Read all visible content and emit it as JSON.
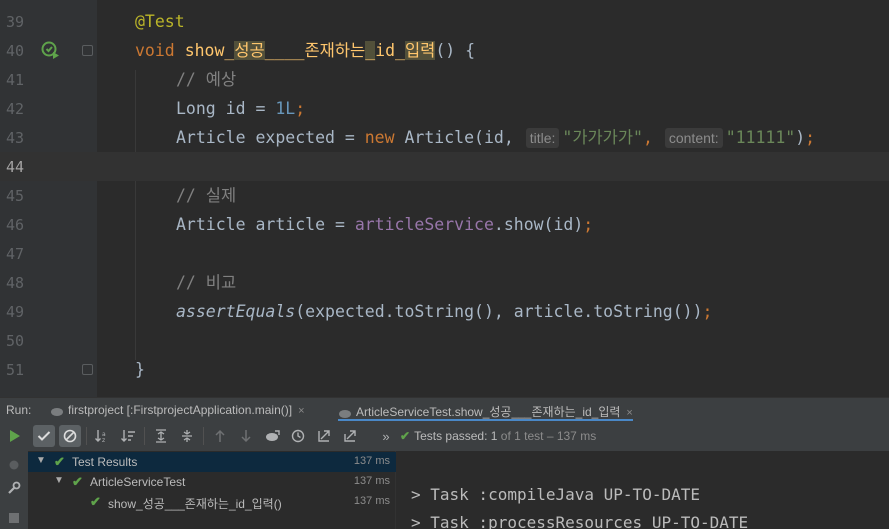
{
  "editor": {
    "lines": [
      {
        "num": "39"
      },
      {
        "num": "40"
      },
      {
        "num": "41"
      },
      {
        "num": "42"
      },
      {
        "num": "43"
      },
      {
        "num": "44"
      },
      {
        "num": "45"
      },
      {
        "num": "46"
      },
      {
        "num": "47"
      },
      {
        "num": "48"
      },
      {
        "num": "49"
      },
      {
        "num": "50"
      },
      {
        "num": "51"
      }
    ],
    "code": {
      "annotation": "@Test",
      "kw_void": "void",
      "method_start": "show_",
      "method_hl1": "성공",
      "method_mid": "____존재하는",
      "method_hl2": "_",
      "method_mid2": "id_",
      "method_hl3": "입력",
      "method_end": "() {",
      "comment_expected": "// 예상",
      "long_type": "Long id = ",
      "long_value": "1L",
      "semicolon": ";",
      "article_decl": "Article expected = ",
      "kw_new": "new",
      "article_ctor": " Article(id, ",
      "hint_title": "title:",
      "str_title": "\"가가가가\"",
      "comma": ", ",
      "hint_content": "content:",
      "str_content": "\"11111\"",
      "close_paren": ")",
      "comment_actual": "// 실제",
      "article_actual": "Article article = ",
      "field_service": "articleService",
      "show_call": ".show(id)",
      "comment_compare": "// 비교",
      "assert_fn": "assertEquals",
      "assert_args": "(expected.toString(), article.toString())",
      "closing_brace": "}"
    },
    "current_line": "44"
  },
  "run_window": {
    "label": "Run:",
    "tabs": [
      {
        "label": "firstproject [:FirstprojectApplication.main()]",
        "close": "×"
      },
      {
        "label": "ArticleServiceTest.show_성공___존재하는_id_입력",
        "close": "×"
      }
    ],
    "toolbar_icons": [
      "rerun-icon",
      "show-passed-icon",
      "show-ignored-icon",
      "sort-alpha-icon",
      "sort-duration-icon",
      "expand-all-icon",
      "collapse-all-icon",
      "prev-failed-icon",
      "next-failed-icon",
      "import-tests-icon",
      "history-icon",
      "export-icon",
      "open-icon"
    ],
    "status": {
      "prefix": "Tests passed: ",
      "passed": "1",
      "suffix": " of 1 test – 137 ms"
    },
    "tree": [
      {
        "label": "Test Results",
        "time": "137 ms"
      },
      {
        "label": "ArticleServiceTest",
        "time": "137 ms"
      },
      {
        "label": "show_성공___존재하는_id_입력()",
        "time": "137 ms"
      }
    ],
    "console": [
      "> Task :compileJava UP-TO-DATE",
      "> Task :processResources UP-TO-DATE"
    ],
    "colors": {
      "pass_green": "#5fa34b",
      "selection": "#0d293e",
      "accent_tab": "#4a88c7"
    }
  }
}
